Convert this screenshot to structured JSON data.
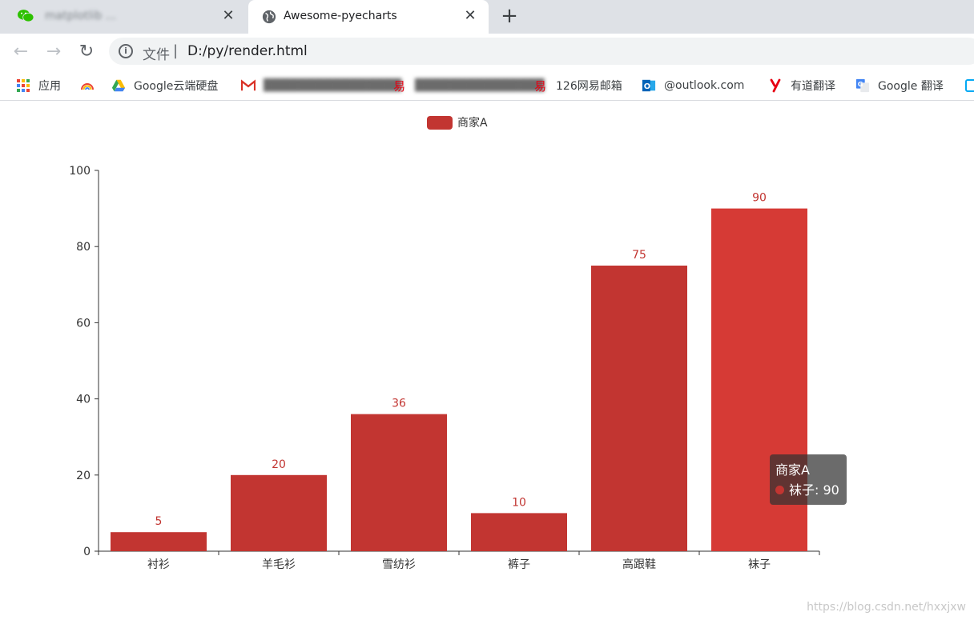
{
  "browser": {
    "tabs": [
      {
        "title": "matplotlib ... ",
        "active": false
      },
      {
        "title": "Awesome-pyecharts",
        "active": true
      }
    ],
    "close_glyph": "✕",
    "new_tab_glyph": "+",
    "address": {
      "scheme_label": "文件",
      "separator": "|",
      "url": "D:/py/render.html"
    },
    "bookmarks": [
      {
        "label": "应用",
        "icon": "apps-grid-icon"
      },
      {
        "label": "",
        "icon": "rainbow-icon"
      },
      {
        "label": "Google云端硬盘",
        "icon": "google-drive-icon"
      },
      {
        "label": "",
        "icon": "gmail-icon",
        "blurred": true
      },
      {
        "label": "",
        "icon": "netease-icon",
        "blurred": true
      },
      {
        "label": "126网易邮箱",
        "icon": "netease-mail-icon"
      },
      {
        "label": "@outlook.com",
        "icon": "outlook-icon"
      },
      {
        "label": "有道翻译",
        "icon": "youdao-icon"
      },
      {
        "label": "Google 翻译",
        "icon": "google-translate-icon"
      }
    ]
  },
  "colors": {
    "bar": "#c23531",
    "bar_emphasis": "#d63a35",
    "axis": "#333333",
    "label": "#c23531"
  },
  "chart_data": {
    "type": "bar",
    "categories": [
      "衬衫",
      "羊毛衫",
      "雪纺衫",
      "裤子",
      "高跟鞋",
      "袜子"
    ],
    "series": [
      {
        "name": "商家A",
        "values": [
          5,
          20,
          36,
          10,
          75,
          90
        ]
      }
    ],
    "y_ticks": [
      0,
      20,
      40,
      60,
      80,
      100
    ],
    "ylim": [
      0,
      100
    ],
    "legend_position": "top-center",
    "grid": false,
    "data_labels": true,
    "highlighted_category": "袜子"
  },
  "tooltip": {
    "series_name": "商家A",
    "line": "袜子: 90"
  },
  "watermark": "https://blog.csdn.net/hxxjxw"
}
